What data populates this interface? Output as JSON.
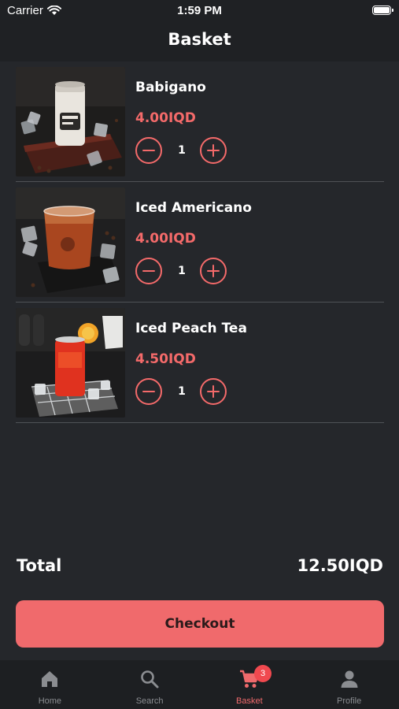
{
  "status_bar": {
    "carrier": "Carrier",
    "time": "1:59 PM"
  },
  "nav": {
    "title": "Basket"
  },
  "basket": {
    "items": [
      {
        "name": "Babigano",
        "price": "4.00IQD",
        "quantity": "1",
        "image": "canned-coffee-photo"
      },
      {
        "name": "Iced Americano",
        "price": "4.00IQD",
        "quantity": "1",
        "image": "iced-americano-photo"
      },
      {
        "name": "Iced Peach Tea",
        "price": "4.50IQD",
        "quantity": "1",
        "image": "iced-peach-tea-photo"
      }
    ]
  },
  "summary": {
    "total_label": "Total",
    "total_value": "12.50IQD"
  },
  "checkout": {
    "label": "Checkout"
  },
  "tabs": [
    {
      "label": "Home",
      "icon": "home-icon"
    },
    {
      "label": "Search",
      "icon": "search-icon"
    },
    {
      "label": "Basket",
      "icon": "cart-icon",
      "badge": "3",
      "active": true
    },
    {
      "label": "Profile",
      "icon": "profile-icon"
    }
  ],
  "colors": {
    "accent": "#f06a6c",
    "background": "#25272b",
    "bar": "#1f2124",
    "inactive_tab": "#8b8d91"
  }
}
